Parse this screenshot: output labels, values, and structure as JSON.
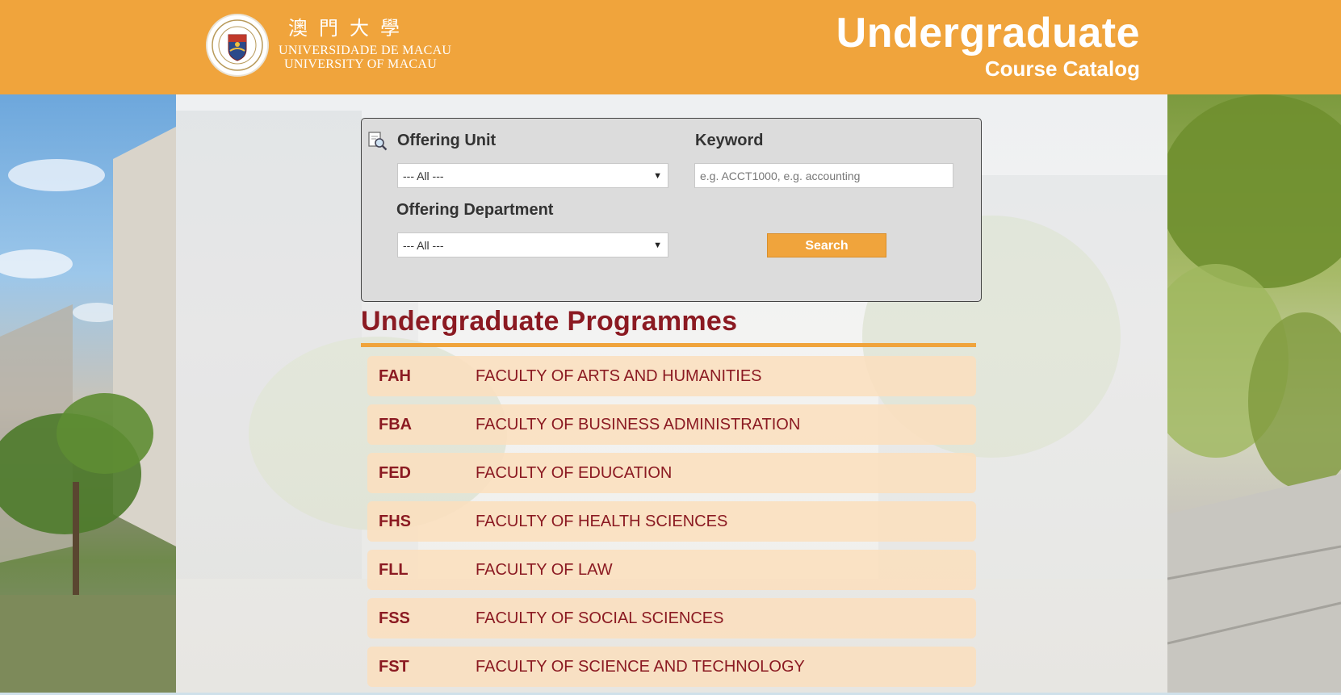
{
  "header": {
    "logo_chinese": "澳門大學",
    "logo_portuguese": "UNIVERSIDADE DE MACAU",
    "logo_english": "UNIVERSITY OF MACAU",
    "seal_text": "UNIVERSIDADE DE MACAU",
    "title": "Undergraduate",
    "subtitle": "Course Catalog"
  },
  "search": {
    "offering_unit_label": "Offering Unit",
    "offering_unit_value": "--- All ---",
    "offering_department_label": "Offering Department",
    "offering_department_value": "--- All ---",
    "keyword_label": "Keyword",
    "keyword_placeholder": "e.g. ACCT1000, e.g. accounting",
    "search_button": "Search"
  },
  "programmes": {
    "title": "Undergraduate Programmes",
    "faculties": [
      {
        "code": "FAH",
        "name": "FACULTY OF ARTS AND HUMANITIES"
      },
      {
        "code": "FBA",
        "name": "FACULTY OF BUSINESS ADMINISTRATION"
      },
      {
        "code": "FED",
        "name": "FACULTY OF EDUCATION"
      },
      {
        "code": "FHS",
        "name": "FACULTY OF HEALTH SCIENCES"
      },
      {
        "code": "FLL",
        "name": "FACULTY OF LAW"
      },
      {
        "code": "FSS",
        "name": "FACULTY OF SOCIAL SCIENCES"
      },
      {
        "code": "FST",
        "name": "FACULTY OF SCIENCE AND TECHNOLOGY"
      }
    ]
  },
  "colors": {
    "header": "#f0a43c",
    "accent_red": "#8b1a22",
    "row_bg": "#fbdfbe"
  }
}
